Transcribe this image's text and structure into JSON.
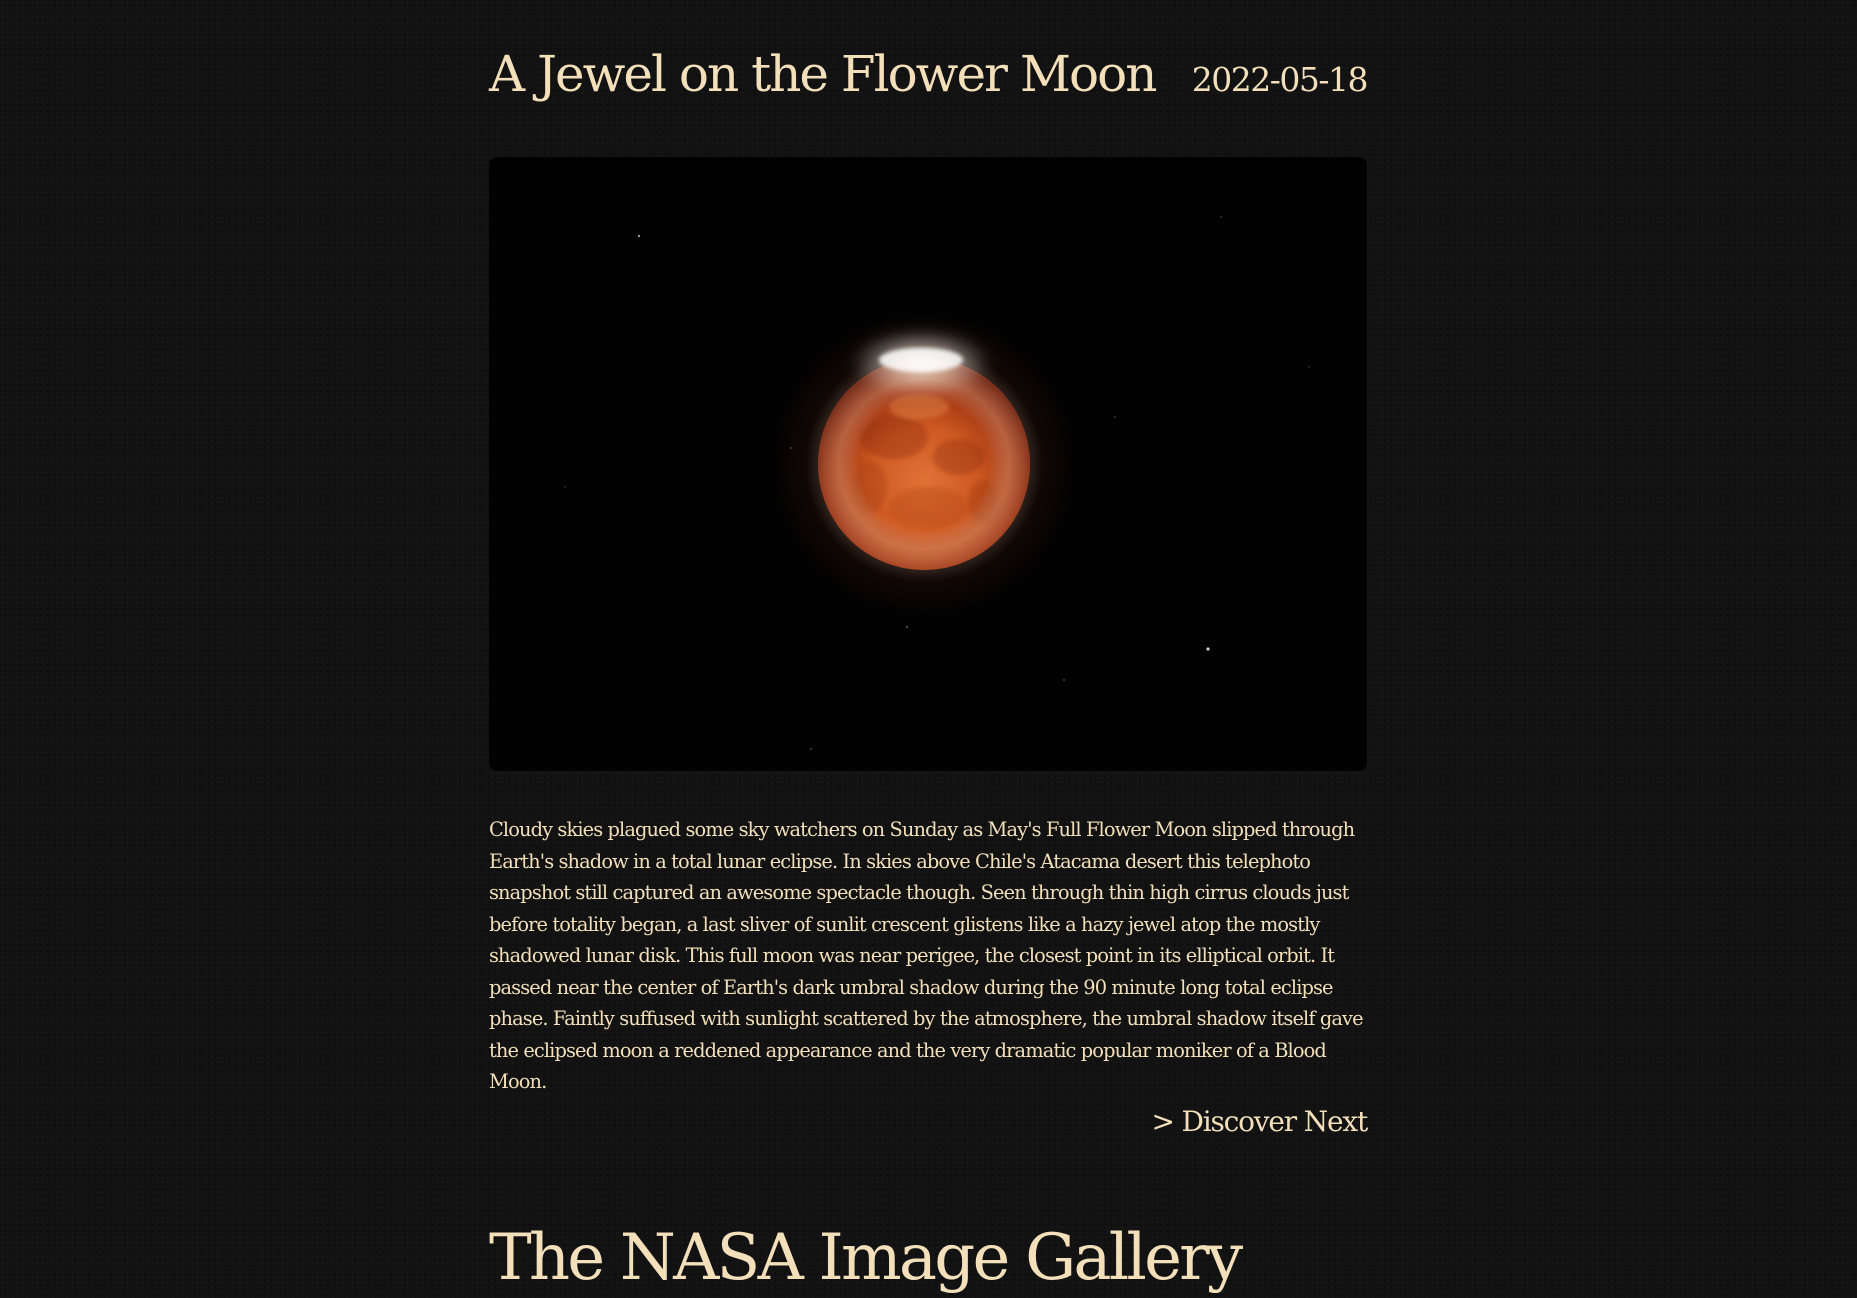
{
  "apod": {
    "title": "A Jewel on the Flower Moon",
    "date": "2022-05-18",
    "image_subject": "Total lunar eclipse – reddened full moon with a bright sliver of sunlit crescent at top",
    "explanation": "Cloudy skies plagued some sky watchers on Sunday as May's Full Flower Moon slipped through Earth's shadow in a total lunar eclipse. In skies above Chile's Atacama desert this telephoto snapshot still captured an awesome spectacle though. Seen through thin high cirrus clouds just before totality began, a last sliver of sunlit crescent glistens like a hazy jewel atop the mostly shadowed lunar disk. This full moon was near perigee, the closest point in its elliptical orbit. It passed near the center of Earth's dark umbral shadow during the 90 minute long total eclipse phase. Faintly suffused with sunlight scattered by the atmosphere, the umbral shadow itself gave the eclipsed moon a reddened appearance and the very dramatic popular moniker of a Blood Moon.",
    "discover_next_label": "> Discover Next"
  },
  "gallery": {
    "title": "The NASA Image Gallery"
  },
  "colors": {
    "background": "#121212",
    "text": "#f3dfba",
    "moon_core": "#d9652a",
    "moon_edge": "#7a1e08"
  }
}
